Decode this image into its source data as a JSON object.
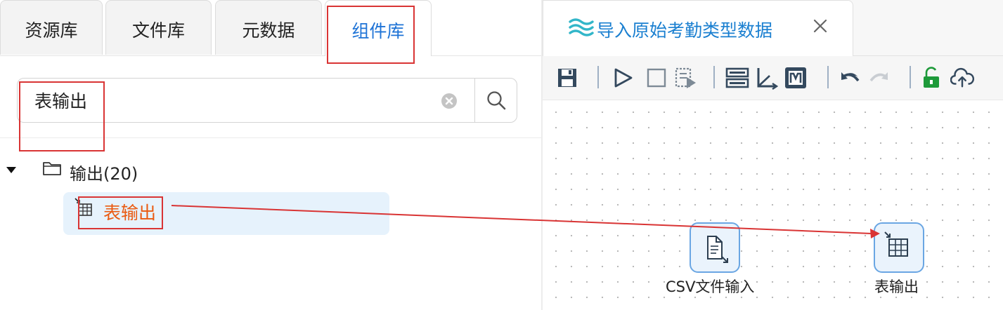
{
  "left_panel": {
    "tabs": [
      {
        "label": "资源库"
      },
      {
        "label": "文件库"
      },
      {
        "label": "元数据"
      },
      {
        "label": "组件库",
        "active": true
      }
    ],
    "search": {
      "value": "表输出",
      "placeholder": ""
    },
    "tree": {
      "folder": {
        "label": "输出(20)",
        "icon": "folder-icon",
        "expanded": true
      },
      "items": [
        {
          "label": "表输出",
          "icon": "table-output-icon",
          "selected": true
        }
      ]
    }
  },
  "editor": {
    "tab": {
      "title": "导入原始考勤类型数据",
      "icon": "waves-icon"
    },
    "toolbar": [
      "save-icon",
      "run-icon",
      "stop-icon",
      "debug-run-icon",
      "layout-icon",
      "axis-icon",
      "marker-icon",
      "undo-icon",
      "redo-icon",
      "unlock-icon",
      "upload-icon"
    ],
    "nodes": [
      {
        "label": "CSV文件输入",
        "icon": "csv-input-icon"
      },
      {
        "label": "表输出",
        "icon": "table-output-icon"
      }
    ]
  },
  "colors": {
    "accent": "#1e73d6",
    "tab_title": "#1a7fd0",
    "selected_item_text": "#ea5a11",
    "selected_item_bg": "#e6f2fc",
    "annotation_red": "#d93434",
    "node_border": "#6aa6e3",
    "unlock_green": "#1e9a3a"
  }
}
